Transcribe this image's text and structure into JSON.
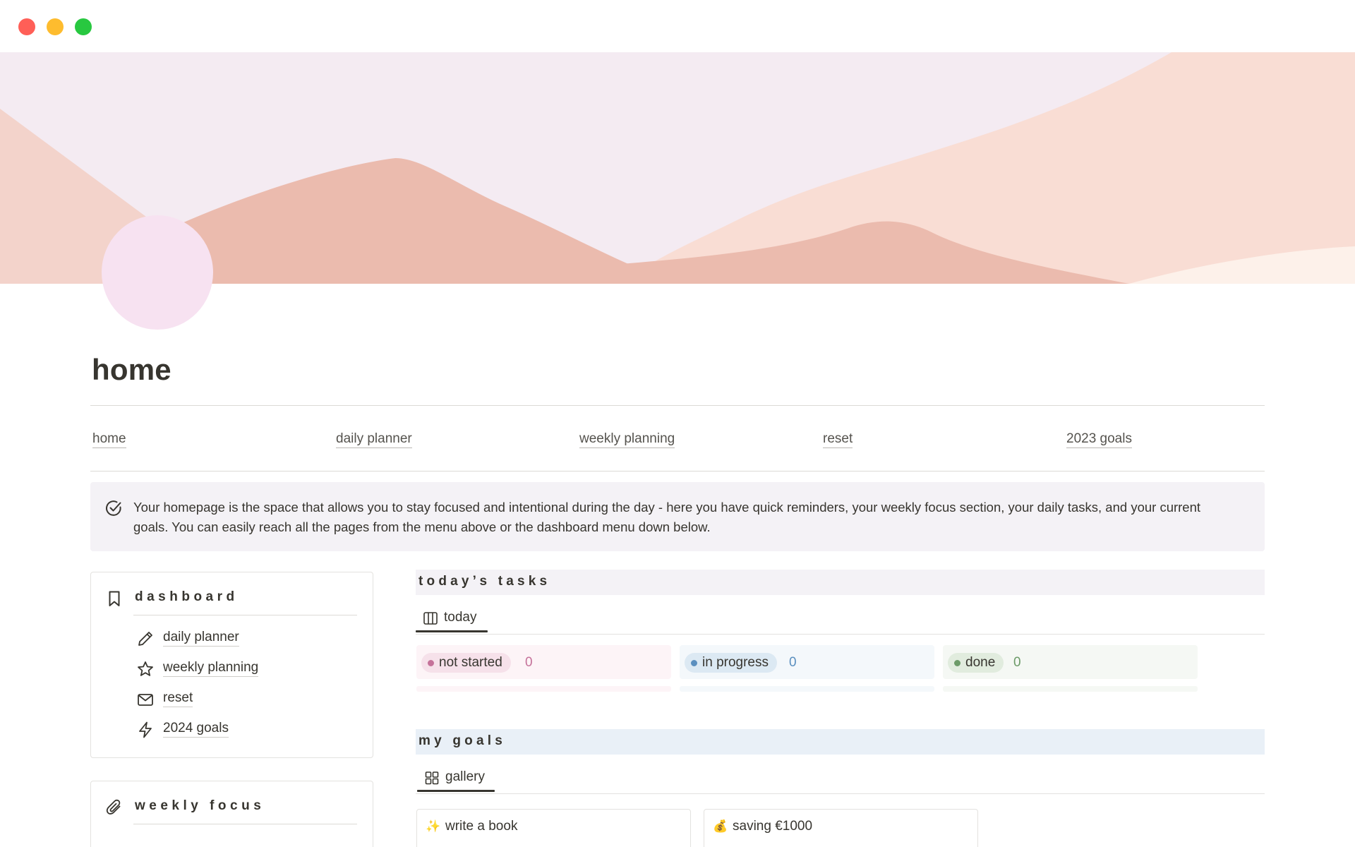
{
  "window": {
    "controls": [
      "close",
      "minimize",
      "zoom"
    ]
  },
  "cover": {
    "colors": {
      "sky": "#f4ebf2",
      "hill_left": "#f3d3cb",
      "hill_mid": "#ebbbae",
      "hill_right": "#f9ddd4",
      "hill_far": "#fdf1ea"
    }
  },
  "page": {
    "icon_color": "#f7e2f1",
    "title": "home"
  },
  "nav": {
    "links": [
      {
        "label": "home"
      },
      {
        "label": "daily planner"
      },
      {
        "label": "weekly planning"
      },
      {
        "label": "reset"
      },
      {
        "label": "2023 goals"
      }
    ]
  },
  "callout": {
    "icon": "check-circle-icon",
    "text": "Your homepage is the space that allows you to stay focused and intentional during the day - here you have quick reminders, your weekly focus section, your daily tasks, and your current goals. You can easily reach all the pages from the menu above or the dashboard menu down below."
  },
  "dashboard": {
    "icon": "bookmark-icon",
    "heading": "dashboard",
    "items": [
      {
        "label": "daily planner",
        "icon": "pencil-icon"
      },
      {
        "label": "weekly planning",
        "icon": "star-icon"
      },
      {
        "label": "reset",
        "icon": "envelope-icon"
      },
      {
        "label": "2024 goals",
        "icon": "lightning-icon"
      }
    ]
  },
  "weekly_focus": {
    "icon": "paperclip-icon",
    "heading": "weekly focus"
  },
  "tasks": {
    "heading": "today’s tasks",
    "view_tab": {
      "label": "today",
      "icon": "board-columns-icon"
    },
    "columns": [
      {
        "label": "not started",
        "count": "0",
        "color": "#c5729a"
      },
      {
        "label": "in progress",
        "count": "0",
        "color": "#5b8fbf"
      },
      {
        "label": "done",
        "count": "0",
        "color": "#6c9b68"
      }
    ]
  },
  "goals": {
    "heading": "my goals",
    "view_tab": {
      "label": "gallery",
      "icon": "gallery-grid-icon"
    },
    "cards": [
      {
        "emoji": "✨",
        "title": "write a book"
      },
      {
        "emoji": "💰",
        "title": "saving €1000"
      }
    ]
  }
}
